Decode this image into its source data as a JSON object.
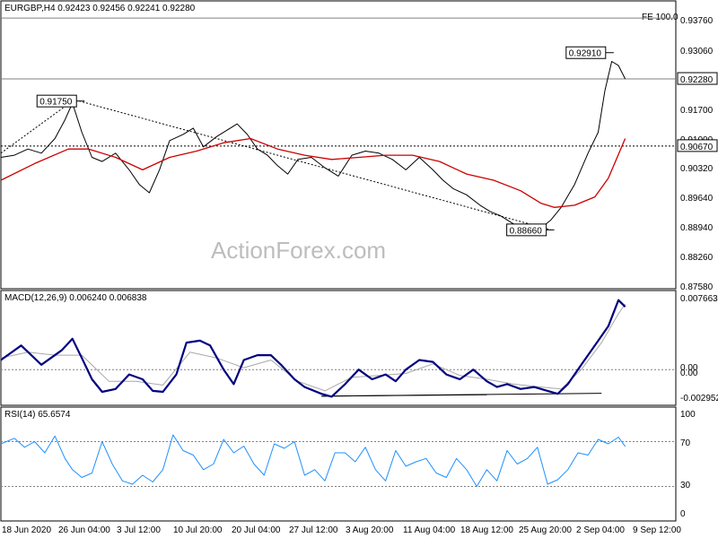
{
  "colors": {
    "background": "#ffffff",
    "frame": "#000000",
    "price": "#000000",
    "ema": "#cc0000",
    "macd": "#000080",
    "signal": "#a8a8a8",
    "rsi": "#1e90ff",
    "guide": "#808080"
  },
  "watermark": "ActionForex.com",
  "chart_data": [
    {
      "type": "line",
      "title": "EURGBP,H4  0.92423 0.92456 0.92241 0.92280",
      "ylim": [
        0.8727,
        0.9413
      ],
      "y_ticks": [
        "0.93760",
        "0.93060",
        "0.92280",
        "0.91700",
        "0.91000",
        "0.90670",
        "0.90320",
        "0.89640",
        "0.88940",
        "0.88260",
        "0.87580"
      ],
      "fe_label": "FE 100.0",
      "fe_level": 0.9374,
      "current_price": "0.92280",
      "current_level": 0.9228,
      "hline_label": "0.90670",
      "hline_level": 0.9067,
      "annotations": [
        {
          "text": "0.91750",
          "x": 0.116,
          "y": 0.9175
        },
        {
          "text": "0.92910",
          "x": 0.9,
          "y": 0.9291
        },
        {
          "text": "0.88660",
          "x": 0.812,
          "y": 0.8866
        }
      ],
      "trendlines": [
        {
          "points": [
            [
              0.0,
              0.905
            ],
            [
              0.106,
              0.9175
            ]
          ]
        },
        {
          "points": [
            [
              0.116,
              0.9175
            ],
            [
              0.815,
              0.8866
            ]
          ]
        }
      ],
      "series": [
        {
          "key": "price",
          "x": [
            0.0,
            0.02,
            0.04,
            0.06,
            0.08,
            0.095,
            0.106,
            0.12,
            0.135,
            0.15,
            0.17,
            0.19,
            0.205,
            0.22,
            0.235,
            0.25,
            0.27,
            0.285,
            0.3,
            0.32,
            0.335,
            0.35,
            0.365,
            0.38,
            0.395,
            0.41,
            0.425,
            0.44,
            0.46,
            0.48,
            0.5,
            0.52,
            0.54,
            0.56,
            0.58,
            0.6,
            0.62,
            0.64,
            0.655,
            0.67,
            0.69,
            0.71,
            0.725,
            0.74,
            0.76,
            0.78,
            0.8,
            0.815,
            0.83,
            0.85,
            0.87,
            0.885,
            0.895,
            0.905,
            0.915,
            0.925
          ],
          "y": [
            0.904,
            0.9045,
            0.906,
            0.905,
            0.9085,
            0.913,
            0.917,
            0.91,
            0.904,
            0.903,
            0.905,
            0.901,
            0.8975,
            0.8955,
            0.901,
            0.908,
            0.9095,
            0.911,
            0.9065,
            0.909,
            0.9105,
            0.912,
            0.9095,
            0.906,
            0.9045,
            0.902,
            0.9,
            0.9035,
            0.904,
            0.9015,
            0.8995,
            0.9045,
            0.9055,
            0.905,
            0.9035,
            0.901,
            0.904,
            0.901,
            0.8985,
            0.8965,
            0.895,
            0.8925,
            0.891,
            0.89,
            0.888,
            0.8875,
            0.887,
            0.889,
            0.892,
            0.8975,
            0.905,
            0.91,
            0.92,
            0.927,
            0.926,
            0.9228
          ]
        },
        {
          "key": "ema",
          "x": [
            0.0,
            0.05,
            0.1,
            0.13,
            0.17,
            0.21,
            0.25,
            0.29,
            0.33,
            0.37,
            0.41,
            0.45,
            0.49,
            0.53,
            0.57,
            0.61,
            0.65,
            0.69,
            0.73,
            0.77,
            0.8,
            0.82,
            0.85,
            0.88,
            0.9,
            0.925
          ],
          "y": [
            0.8985,
            0.9025,
            0.906,
            0.906,
            0.904,
            0.901,
            0.904,
            0.9055,
            0.9075,
            0.9085,
            0.906,
            0.9045,
            0.9035,
            0.904,
            0.9045,
            0.9045,
            0.903,
            0.9,
            0.8985,
            0.896,
            0.893,
            0.892,
            0.8925,
            0.8945,
            0.899,
            0.9085
          ]
        }
      ]
    },
    {
      "type": "line",
      "title": "MACD(12,26,9) 0.006240 0.006838",
      "ylim": [
        -0.0036,
        0.0081
      ],
      "y_ticks": [
        "0.007663",
        "0.00",
        "0.00",
        "-0.002952"
      ],
      "value_label": "0.007663",
      "zero_label_a": "0.00",
      "zero_label_b": "0.00",
      "low_label": "-0.002952",
      "low_level": -0.002952,
      "divergence_lines": [
        {
          "points": [
            [
              0.475,
              -0.00275
            ],
            [
              0.89,
              -0.00245
            ]
          ]
        },
        {
          "points": [
            [
              0.475,
              -0.00275
            ],
            [
              0.72,
              -0.0026
            ]
          ]
        }
      ],
      "series": [
        {
          "key": "macd",
          "x": [
            0.0,
            0.03,
            0.06,
            0.09,
            0.106,
            0.12,
            0.135,
            0.15,
            0.17,
            0.19,
            0.21,
            0.225,
            0.24,
            0.26,
            0.275,
            0.295,
            0.31,
            0.33,
            0.345,
            0.36,
            0.38,
            0.4,
            0.415,
            0.435,
            0.45,
            0.475,
            0.49,
            0.51,
            0.53,
            0.55,
            0.57,
            0.585,
            0.6,
            0.62,
            0.64,
            0.66,
            0.68,
            0.7,
            0.72,
            0.735,
            0.75,
            0.77,
            0.79,
            0.81,
            0.825,
            0.84,
            0.86,
            0.88,
            0.9,
            0.915,
            0.925
          ],
          "y": [
            0.001,
            0.0025,
            0.0005,
            0.002,
            0.0032,
            0.0012,
            -0.001,
            -0.0023,
            -0.002,
            -0.0005,
            -0.001,
            -0.0022,
            -0.0023,
            -0.0005,
            0.0028,
            0.003,
            0.0025,
            0.0,
            -0.0015,
            0.001,
            0.0015,
            0.0015,
            0.0005,
            -0.001,
            -0.0018,
            -0.0025,
            -0.0028,
            -0.0015,
            0.0,
            -0.001,
            -0.0005,
            -0.0012,
            0.0,
            0.001,
            0.0008,
            -0.0005,
            -0.001,
            0.0,
            -0.0012,
            -0.0018,
            -0.0015,
            -0.002,
            -0.0018,
            -0.0022,
            -0.0025,
            -0.0015,
            0.0005,
            0.0025,
            0.0045,
            0.0072,
            0.0065
          ]
        },
        {
          "key": "signal",
          "x": [
            0.0,
            0.04,
            0.08,
            0.12,
            0.16,
            0.2,
            0.24,
            0.28,
            0.32,
            0.36,
            0.4,
            0.44,
            0.48,
            0.52,
            0.56,
            0.6,
            0.64,
            0.68,
            0.72,
            0.76,
            0.8,
            0.83,
            0.86,
            0.89,
            0.915,
            0.925
          ],
          "y": [
            0.0012,
            0.0018,
            0.0015,
            0.0015,
            -0.0012,
            -0.0012,
            -0.0016,
            0.0018,
            0.0012,
            0.0002,
            0.001,
            -0.0012,
            -0.0022,
            -0.0008,
            -0.0006,
            -0.0004,
            0.0006,
            -0.0006,
            -0.001,
            -0.0015,
            -0.0018,
            -0.002,
            0.0,
            0.0028,
            0.0058,
            0.0068
          ]
        }
      ]
    },
    {
      "type": "line",
      "title": "RSI(14) 65.6574",
      "ylim": [
        0,
        100
      ],
      "y_ticks": [
        "100",
        "70",
        "30",
        "0"
      ],
      "levels": [
        70,
        30
      ],
      "series": [
        {
          "key": "rsi",
          "x": [
            0.0,
            0.02,
            0.035,
            0.05,
            0.065,
            0.08,
            0.095,
            0.106,
            0.12,
            0.135,
            0.15,
            0.165,
            0.18,
            0.195,
            0.21,
            0.225,
            0.24,
            0.255,
            0.27,
            0.285,
            0.3,
            0.315,
            0.33,
            0.345,
            0.36,
            0.375,
            0.39,
            0.405,
            0.42,
            0.435,
            0.45,
            0.465,
            0.48,
            0.495,
            0.51,
            0.525,
            0.54,
            0.555,
            0.57,
            0.585,
            0.6,
            0.615,
            0.63,
            0.645,
            0.66,
            0.675,
            0.69,
            0.705,
            0.72,
            0.735,
            0.75,
            0.765,
            0.78,
            0.795,
            0.81,
            0.825,
            0.84,
            0.855,
            0.87,
            0.885,
            0.9,
            0.915,
            0.925
          ],
          "y": [
            68,
            73,
            65,
            70,
            60,
            75,
            55,
            45,
            38,
            42,
            70,
            50,
            35,
            32,
            40,
            34,
            45,
            76,
            62,
            58,
            45,
            50,
            72,
            60,
            66,
            50,
            40,
            68,
            64,
            70,
            40,
            45,
            35,
            60,
            60,
            52,
            65,
            45,
            35,
            62,
            48,
            52,
            55,
            42,
            38,
            55,
            45,
            30,
            45,
            35,
            62,
            50,
            55,
            65,
            32,
            36,
            45,
            60,
            58,
            72,
            68,
            74,
            65.7
          ]
        }
      ]
    }
  ],
  "x_axis": {
    "labels": [
      "18 Jun 2020",
      "26 Jun 04:00",
      "3 Jul 12:00",
      "10 Jul 20:00",
      "20 Jul 04:00",
      "27 Jul 12:00",
      "3 Aug 20:00",
      "11 Aug 04:00",
      "18 Aug 12:00",
      "25 Aug 20:00",
      "2 Sep 04:00",
      "9 Sep 12:00"
    ]
  }
}
